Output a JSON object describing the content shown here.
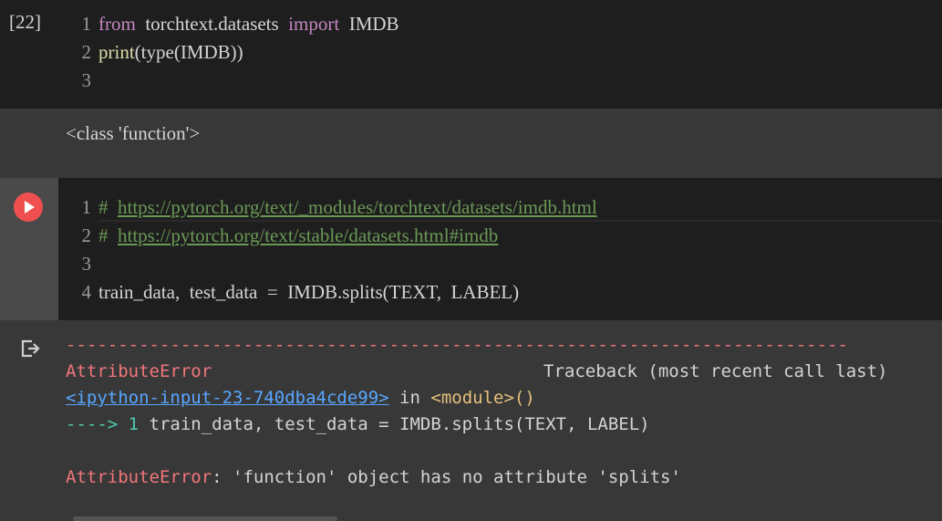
{
  "cell1": {
    "exec_count": "[22]",
    "line_numbers": [
      "1",
      "2",
      "3"
    ],
    "lines": {
      "l1_kw1": "from",
      "l1_mod": "torchtext.datasets",
      "l1_kw2": "import",
      "l1_name": "IMDB",
      "l2_fn": "print",
      "l2_rest": "(type(IMDB))"
    }
  },
  "output1": {
    "text": "<class 'function'>"
  },
  "cell2": {
    "line_numbers": [
      "1",
      "2",
      "3",
      "4"
    ],
    "comment_hash": "#",
    "link1": "https://pytorch.org/text/_modules/torchtext/datasets/imdb.html",
    "link2": "https://pytorch.org/text/stable/datasets.html#imdb",
    "line4": "train_data,  test_data  =  IMDB.splits(TEXT,  LABEL)"
  },
  "output2": {
    "dashes": "---------------------------------------------------------------------------",
    "error_name": "AttributeError",
    "traceback_label": "Traceback (most recent call last)",
    "input_link": "<ipython-input-23-740dba4cde99>",
    "in_text": " in ",
    "module_text": "<module>()",
    "arrow": "----> 1",
    "arrow_line": " train_data, test_data = IMDB.splits(TEXT, LABEL)",
    "final_error_name": "AttributeError",
    "final_error_msg": ": 'function' object has no attribute 'splits'"
  },
  "colors": {
    "run_button": "#f04f4f",
    "error_red": "#f0767b",
    "link_blue": "#58a6ff",
    "comment_green": "#6a9955"
  }
}
